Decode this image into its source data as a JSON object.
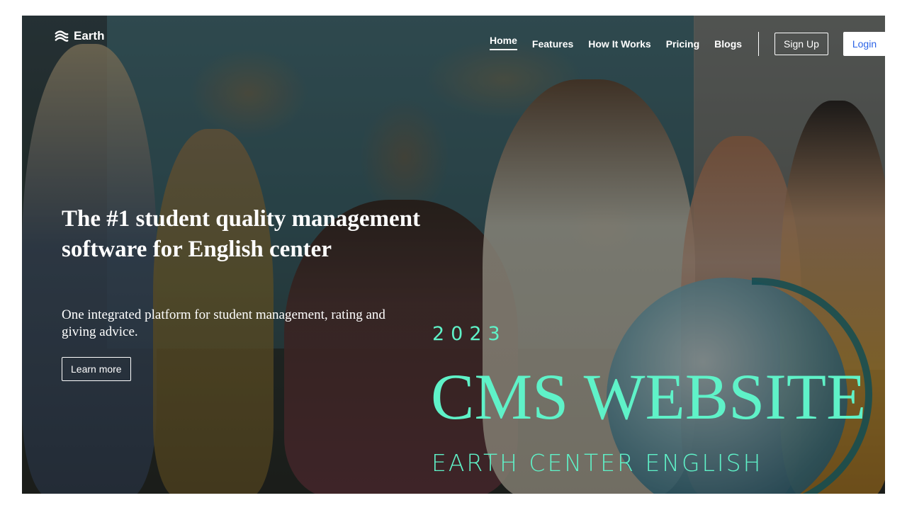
{
  "brand": {
    "name": "Earth",
    "icon": "waves-icon"
  },
  "nav": {
    "items": [
      {
        "label": "Home",
        "active": true
      },
      {
        "label": "Features",
        "active": false
      },
      {
        "label": "How It Works",
        "active": false
      },
      {
        "label": "Pricing",
        "active": false
      },
      {
        "label": "Blogs",
        "active": false
      }
    ],
    "signup_label": "Sign Up",
    "login_label": "Login"
  },
  "hero": {
    "headline": "The #1 student quality management software for English center",
    "subhead": "One integrated platform for student management, rating and giving advice.",
    "cta_label": "Learn more"
  },
  "promo": {
    "year": "2023",
    "title": "CMS WEBSITE",
    "subtitle": "EARTH CENTER ENGLISH"
  },
  "colors": {
    "accent": "#5ff2c8",
    "login_text": "#2b63e6",
    "text": "#ffffff"
  }
}
